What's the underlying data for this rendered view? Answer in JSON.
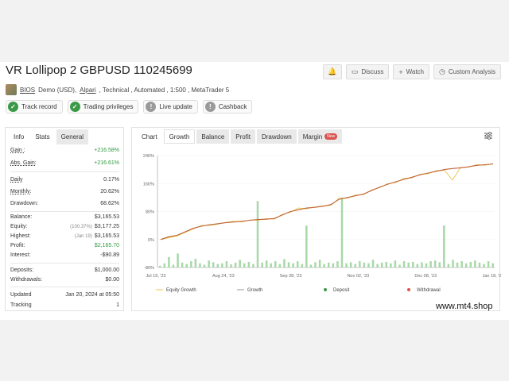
{
  "header": {
    "title": "VR Lollipop 2 GBPUSD 110245699",
    "buttons": {
      "discuss": "Discuss",
      "watch": "Watch",
      "custom_analysis": "Custom Analysis"
    },
    "icons": {
      "bell": "bell-icon",
      "discuss": "chat-icon",
      "watch": "plus-icon",
      "analysis": "clock-icon"
    }
  },
  "account": {
    "user": "BIOS",
    "type": "Demo (USD),",
    "broker": "Alpari",
    "details": ", Technical , Automated , 1:500 , MetaTrader 5"
  },
  "badges": [
    {
      "label": "Track record",
      "state": "ok"
    },
    {
      "label": "Trading privileges",
      "state": "ok"
    },
    {
      "label": "Live update",
      "state": "warn"
    },
    {
      "label": "Cashback",
      "state": "warn"
    }
  ],
  "left_tabs": {
    "info": "Info",
    "stats": "Stats",
    "general": "General"
  },
  "stats": {
    "gain": {
      "label": "Gain :",
      "value": "+216.58%"
    },
    "abs_gain": {
      "label": "Abs. Gain:",
      "value": "+216.61%"
    },
    "daily": {
      "label": "Daily",
      "value": "0.17%"
    },
    "monthly": {
      "label": "Monthly:",
      "value": "20.62%"
    },
    "drawdown": {
      "label": "Drawdown:",
      "value": "68.62%"
    },
    "balance": {
      "label": "Balance:",
      "value": "$3,165.53"
    },
    "equity": {
      "label": "Equity:",
      "pct": "(100.37%)",
      "value": "$3,177.25"
    },
    "highest": {
      "label": "Highest:",
      "date": "(Jan 19)",
      "value": "$3,165.53"
    },
    "profit": {
      "label": "Profit:",
      "value": "$2,165.70"
    },
    "interest": {
      "label": "Interest:",
      "value": "-$90.89"
    },
    "deposits": {
      "label": "Deposits:",
      "value": "$1,000.00"
    },
    "withdrawals": {
      "label": "Withdrawals:",
      "value": "$0.00"
    },
    "updated": {
      "label": "Updated",
      "value": "Jan 20, 2024 at 05:50"
    },
    "tracking": {
      "label": "Tracking",
      "value": "1"
    }
  },
  "chart_tabs": {
    "chart": "Chart",
    "growth": "Growth",
    "balance": "Balance",
    "profit": "Profit",
    "drawdown": "Drawdown",
    "margin": "Margin",
    "new": "New"
  },
  "chart_data": {
    "type": "line",
    "y_ticks": [
      "240%",
      "160%",
      "80%",
      "0%",
      "-80%"
    ],
    "ylim": [
      -80,
      240
    ],
    "x_ticks": [
      "Jul 19, '23",
      "Aug 24, '23",
      "Sep 28, '23",
      "Nov 02, '23",
      "Dec 08, '23",
      "Jan 18, '24"
    ],
    "legend": {
      "equity_growth": "Equity Growth",
      "growth": "Growth",
      "deposit": "Deposit",
      "withdrawal": "Withdrawal"
    },
    "colors": {
      "equity_growth": "#e8c44a",
      "growth": "#c0643a",
      "deposit": "#3a9a47",
      "withdrawal": "#d9534f",
      "bars": "#a8d8a8"
    },
    "series": [
      {
        "name": "Growth",
        "values": [
          0,
          8,
          12,
          22,
          32,
          38,
          42,
          45,
          48,
          50,
          52,
          55,
          57,
          58,
          60,
          70,
          80,
          85,
          90,
          92,
          95,
          100,
          115,
          120,
          125,
          130,
          140,
          150,
          158,
          165,
          172,
          178,
          185,
          190,
          195,
          200,
          203,
          205,
          208,
          212,
          214,
          216
        ]
      },
      {
        "name": "Equity Growth",
        "values": [
          0,
          5,
          10,
          20,
          30,
          40,
          40,
          44,
          49,
          52,
          50,
          56,
          55,
          60,
          58,
          72,
          78,
          90,
          88,
          93,
          96,
          98,
          118,
          118,
          127,
          128,
          142,
          148,
          160,
          163,
          175,
          176,
          187,
          188,
          197,
          198,
          170,
          206,
          207,
          214,
          212,
          217
        ]
      }
    ],
    "bars": [
      5,
      12,
      30,
      8,
      40,
      14,
      10,
      18,
      25,
      12,
      8,
      20,
      15,
      10,
      12,
      18,
      9,
      14,
      22,
      12,
      16,
      10,
      190,
      14,
      20,
      12,
      18,
      10,
      24,
      15,
      12,
      18,
      10,
      120,
      8,
      15,
      22,
      10,
      14,
      12,
      18,
      200,
      12,
      15,
      10,
      18,
      14,
      12,
      22,
      10,
      14,
      16,
      12,
      20,
      8,
      18,
      14,
      16,
      10,
      15,
      12,
      18,
      20,
      15,
      120,
      10,
      22,
      14,
      18,
      12,
      16,
      20,
      14,
      10,
      18,
      12
    ]
  },
  "watermark": "www.mt4.shop"
}
